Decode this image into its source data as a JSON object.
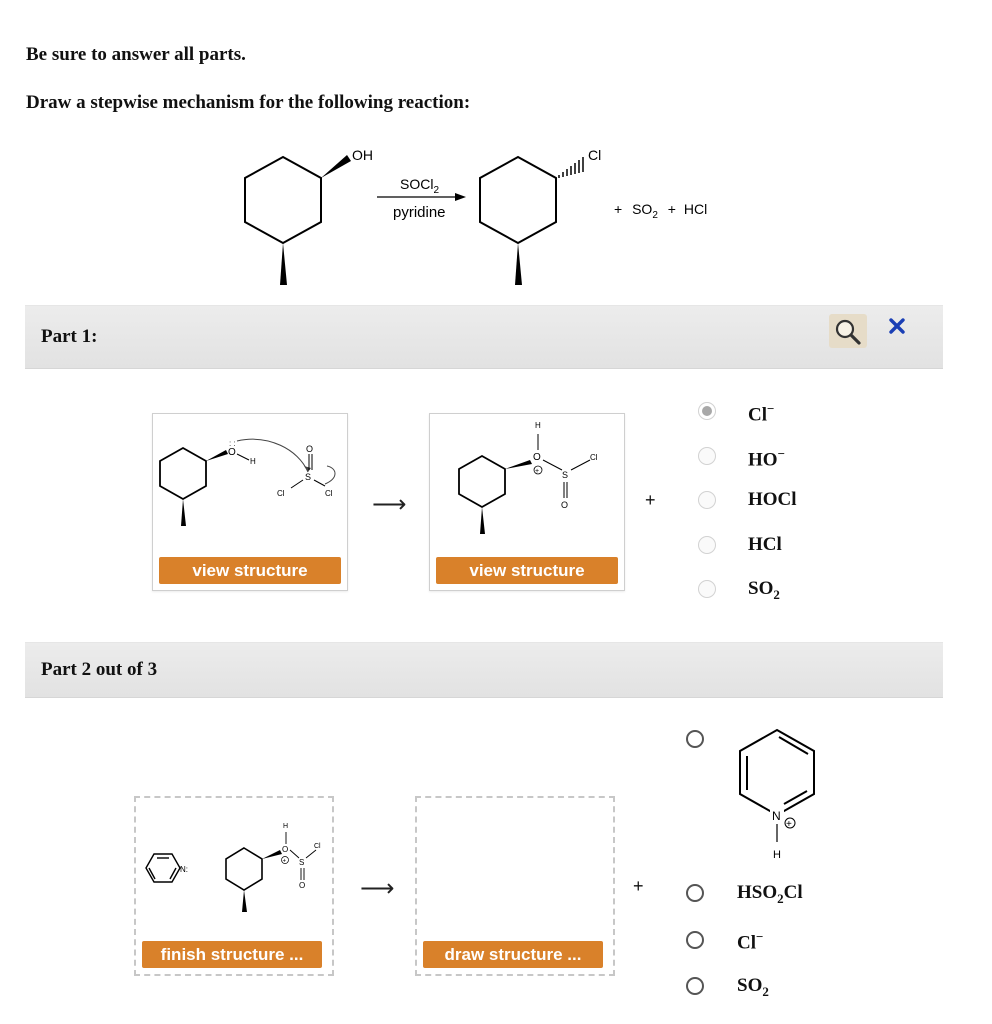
{
  "instructions": {
    "line1": "Be sure to answer all parts.",
    "line2": "Draw a stepwise mechanism for the following reaction:"
  },
  "reaction": {
    "reactant_label": "OH",
    "reagent_top_prefix": "SOCl",
    "reagent_top_sub": "2",
    "reagent_bottom": "pyridine",
    "product_label": "Cl",
    "byproducts": [
      "+",
      "SO",
      "2",
      "+",
      "HCl"
    ]
  },
  "part1": {
    "label": "Part 1:",
    "view_button_1": "view structure",
    "view_button_2": "view structure",
    "plus": "+",
    "options": [
      {
        "main": "Cl",
        "sup": "−",
        "sub": "",
        "tail": "",
        "selected": true
      },
      {
        "main": "HO",
        "sup": "−",
        "sub": "",
        "tail": "",
        "selected": false
      },
      {
        "main": "HOCl",
        "sup": "",
        "sub": "",
        "tail": "",
        "selected": false
      },
      {
        "main": "HCl",
        "sup": "",
        "sub": "",
        "tail": "",
        "selected": false
      },
      {
        "main": "SO",
        "sup": "",
        "sub": "2",
        "tail": "",
        "selected": false
      }
    ],
    "structure_text": {
      "o": "O",
      "h": "H",
      "s": "S",
      "cl": "Cl",
      "plus_charge": "+"
    }
  },
  "part2": {
    "label": "Part 2 out of 3",
    "finish_button": "finish structure ...",
    "draw_button": "draw structure ...",
    "plus": "+",
    "pyridinium": {
      "n": "N",
      "h": "H",
      "charge": "+"
    },
    "pyridine_n": "N:",
    "options": [
      {
        "main": "HSO",
        "sub": "2",
        "tail": "Cl",
        "sup": ""
      },
      {
        "main": "Cl",
        "sub": "",
        "tail": "",
        "sup": "−"
      },
      {
        "main": "SO",
        "sub": "2",
        "tail": "",
        "sup": ""
      }
    ]
  },
  "toolbar": {
    "zoom_icon": "magnifier-icon",
    "close_icon": "close-x-icon",
    "close_color": "#1a3fb5",
    "zoom_bg": "#e6dcc8"
  },
  "colors": {
    "accent_orange": "#d9812a",
    "part_bar": "#e6e6e6"
  }
}
